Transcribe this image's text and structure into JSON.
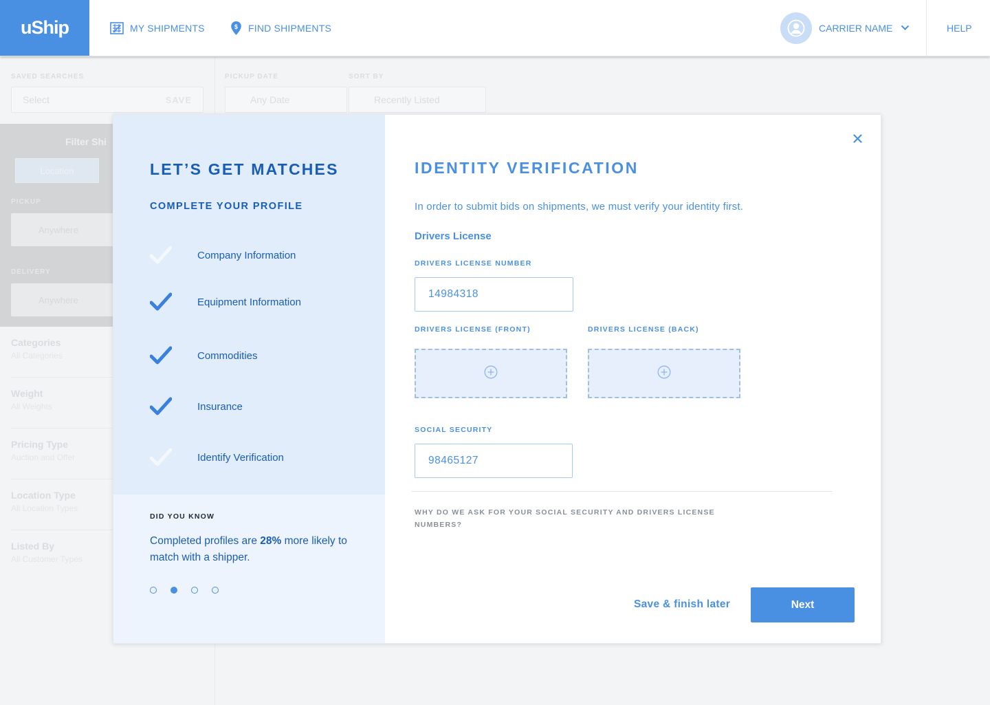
{
  "brand": {
    "logo_text": "uShip",
    "accent": "#4a90e2",
    "dark_accent": "#1a5db5"
  },
  "nav": {
    "my_shipments": "MY SHIPMENTS",
    "find_shipments": "FIND SHIPMENTS",
    "user_name": "CARRIER NAME",
    "help": "HELP"
  },
  "background": {
    "saved_searches_label": "SAVED SEARCHES",
    "saved_searches_value": "Select",
    "save_label": "SAVE",
    "pickup_date_label": "PICKUP DATE",
    "pickup_date_value": "Any Date",
    "sort_by_label": "SORT BY",
    "sort_by_value": "Recently Listed",
    "filter_title": "Filter Shi",
    "location_tab": "Location",
    "pickup_label": "PICKUP",
    "pickup_value": "Anywhere",
    "delivery_label": "DELIVERY",
    "delivery_value": "Anywhere",
    "filters": [
      {
        "title": "Categories",
        "sub": "All Categories"
      },
      {
        "title": "Weight",
        "sub": "All Weights"
      },
      {
        "title": "Pricing Type",
        "sub": "Auction and Offer"
      },
      {
        "title": "Location Type",
        "sub": "All Location Types"
      },
      {
        "title": "Listed By",
        "sub": "All Customer Types"
      }
    ]
  },
  "modal": {
    "left": {
      "title": "LET’S GET MATCHES",
      "subtitle": "COMPLETE YOUR PROFILE",
      "steps": [
        {
          "label": "Company Information",
          "done": false
        },
        {
          "label": "Equipment Information",
          "done": true
        },
        {
          "label": "Commodities",
          "done": true
        },
        {
          "label": "Insurance",
          "done": true
        },
        {
          "label": "Identify Verification",
          "done": false
        }
      ],
      "did_you_know_label": "DID YOU KNOW",
      "tip_before": "Completed profiles are ",
      "tip_highlight": "28%",
      "tip_after": " more likely to match with a shipper.",
      "carousel_active_index": 1
    },
    "right": {
      "title": "IDENTITY VERIFICATION",
      "intro": "In order to submit bids on shipments, we must verify your identity first.",
      "section": "Drivers License",
      "dl_number_label": "DRIVERS LICENSE NUMBER",
      "dl_number_value": "14984318",
      "dl_front_label": "DRIVERS LICENSE (FRONT)",
      "dl_back_label": "DRIVERS LICENSE (BACK)",
      "ssn_label": "SOCIAL SECURITY",
      "ssn_value": "98465127",
      "why_text": "WHY DO WE ASK FOR YOUR SOCIAL SECURITY AND DRIVERS LICENSE NUMBERS?",
      "save_later": "Save & finish later",
      "next": "Next"
    }
  },
  "icons": {
    "my_shipments": "shipments-grid-icon",
    "find_shipments": "location-pin-dollar-icon",
    "avatar": "user-avatar-icon",
    "dropdown": "chevron-down-icon",
    "close": "close-icon",
    "upload": "plus-circle-icon",
    "step_check": "checkmark-icon"
  }
}
